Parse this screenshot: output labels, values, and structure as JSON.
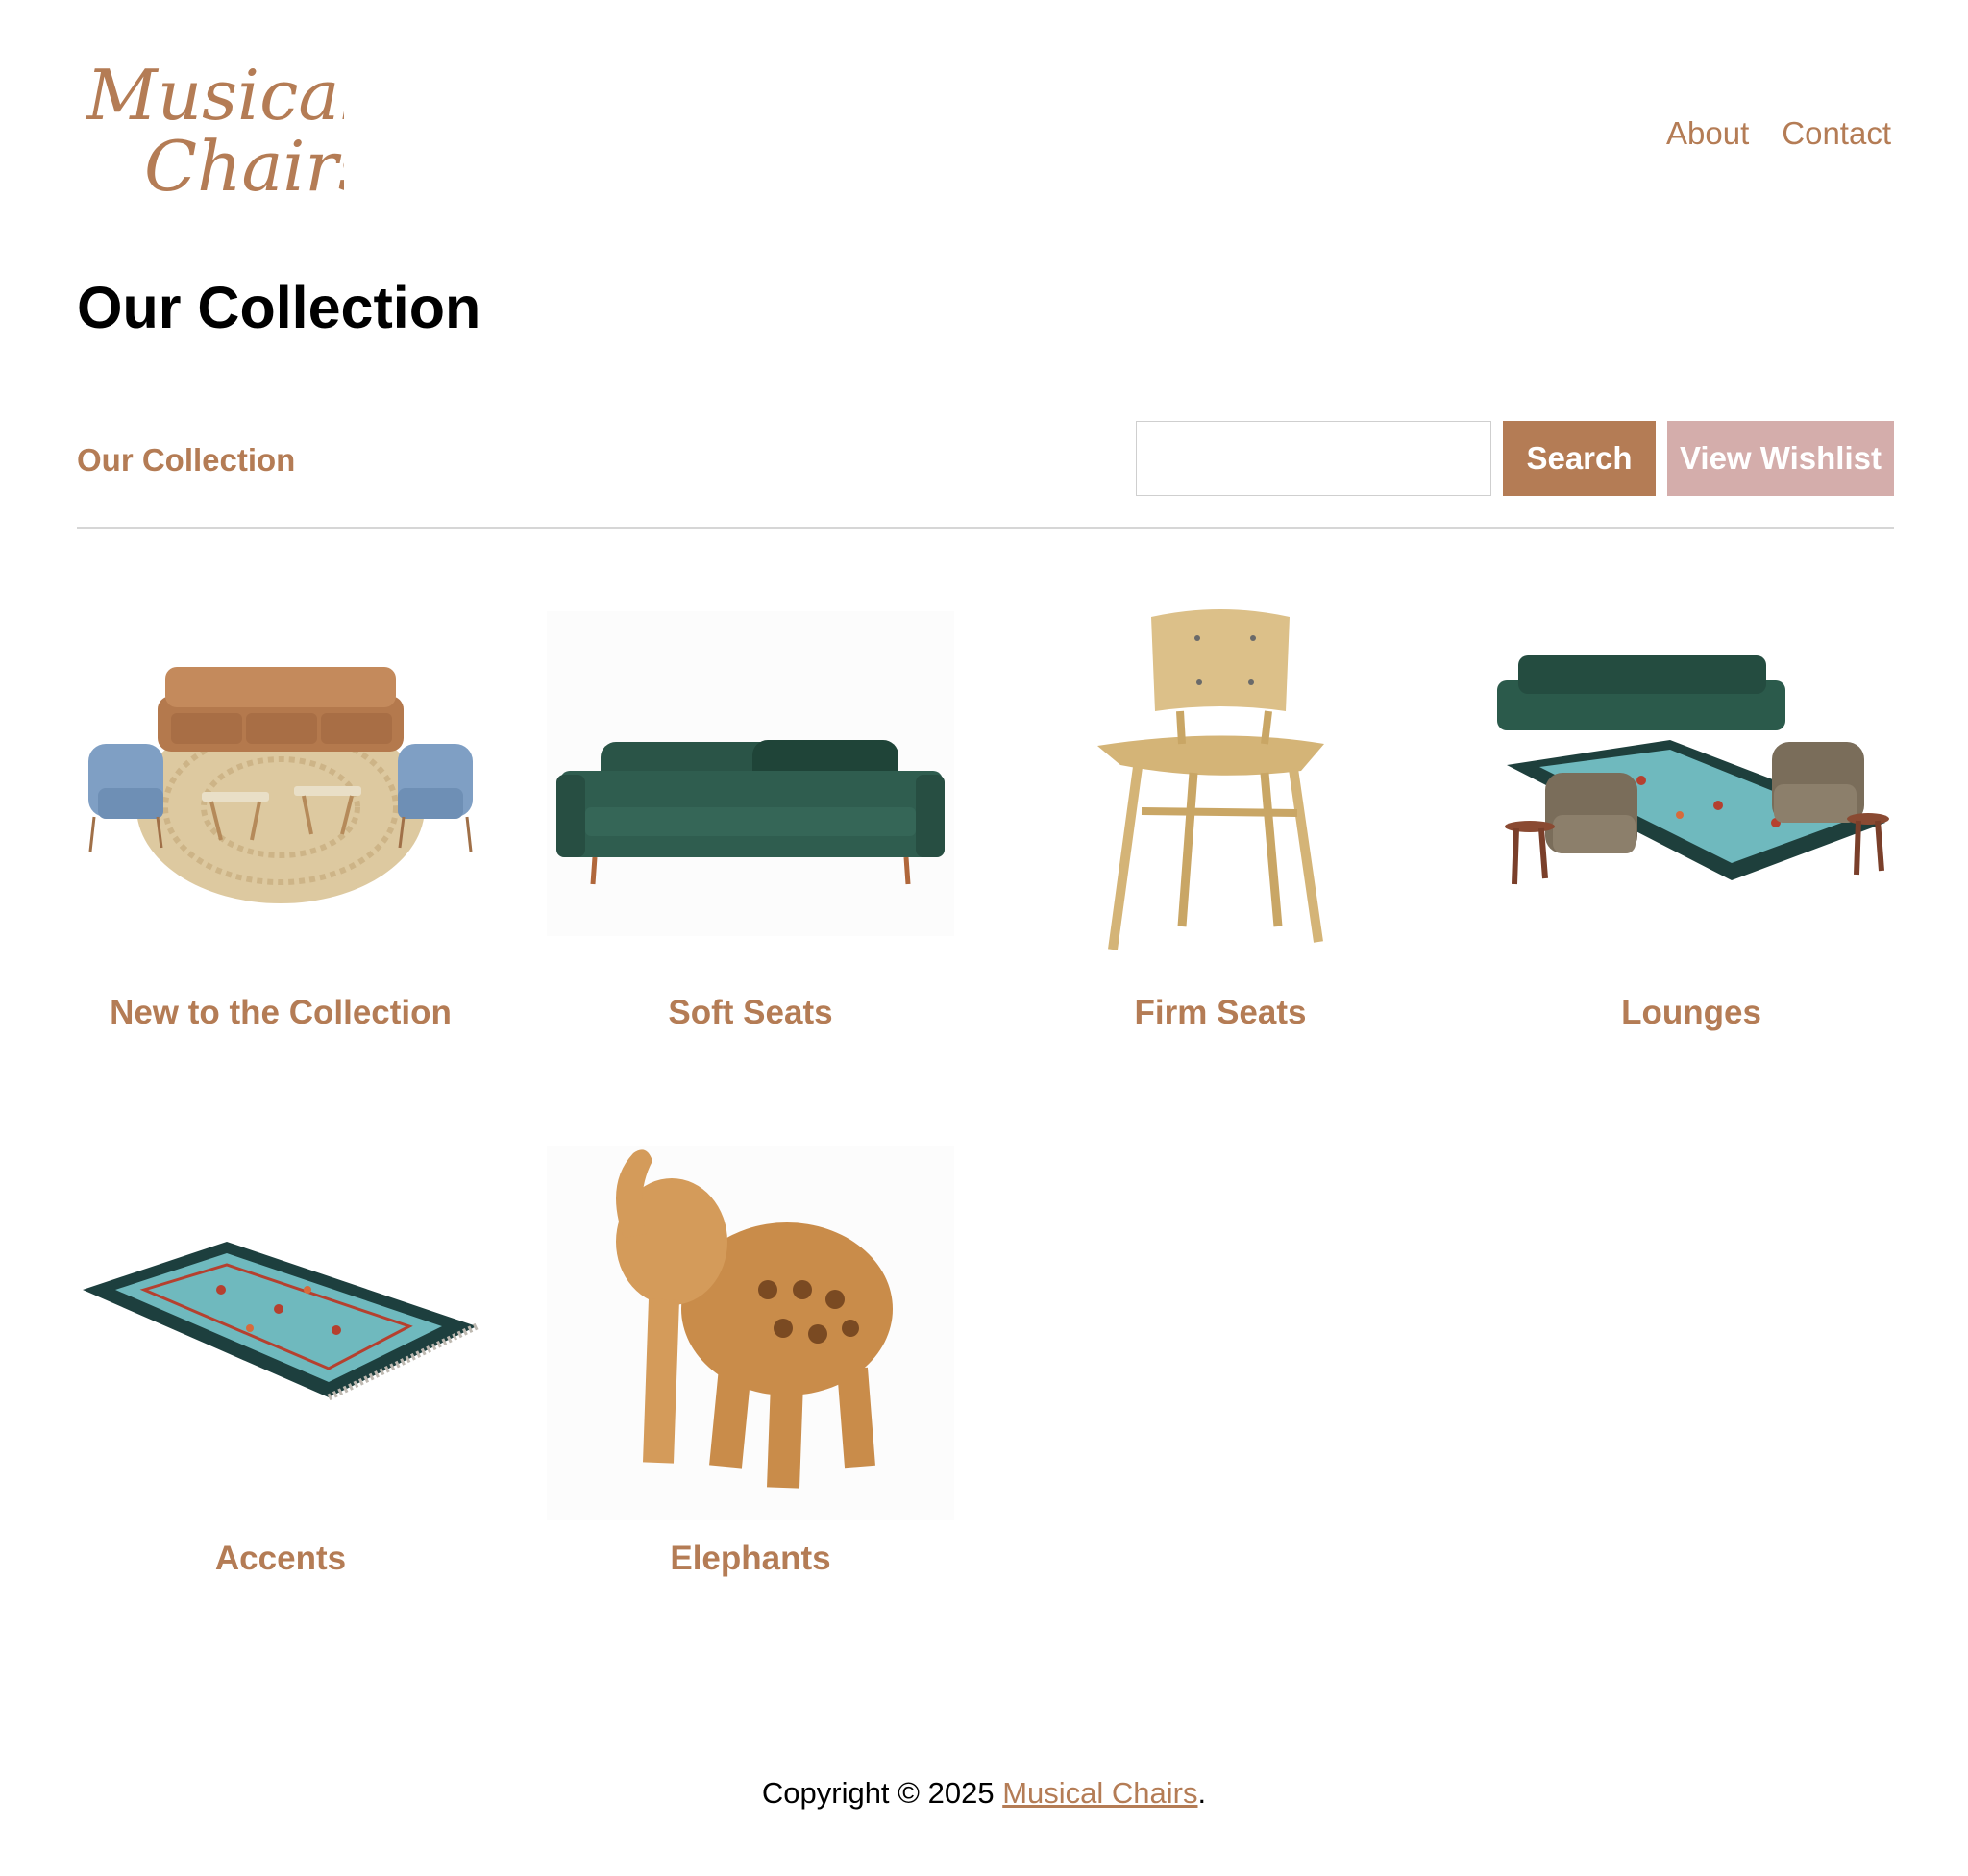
{
  "header": {
    "logo": {
      "line1": "Musical",
      "line2": "Chairs"
    },
    "nav": [
      {
        "label": "About"
      },
      {
        "label": "Contact"
      }
    ]
  },
  "page": {
    "title": "Our Collection"
  },
  "toolbar": {
    "label": "Our Collection",
    "search_value": "",
    "search_label": "Search",
    "wishlist_label": "View Wishlist"
  },
  "collections": [
    {
      "label": "New to the Collection",
      "image": "sofa-set-image"
    },
    {
      "label": "Soft Seats",
      "image": "green-sofa-image"
    },
    {
      "label": "Firm Seats",
      "image": "wooden-chair-image"
    },
    {
      "label": "Lounges",
      "image": "lounge-set-image"
    },
    {
      "label": "Accents",
      "image": "rug-image"
    },
    {
      "label": "Elephants",
      "image": "elephant-figurine-image"
    }
  ],
  "footer": {
    "prefix": "Copyright © 2025 ",
    "link": "Musical Chairs",
    "suffix": "."
  },
  "colors": {
    "accent": "#b47c55",
    "wishlist": "#d4adab",
    "divider": "#d6d6d6"
  }
}
